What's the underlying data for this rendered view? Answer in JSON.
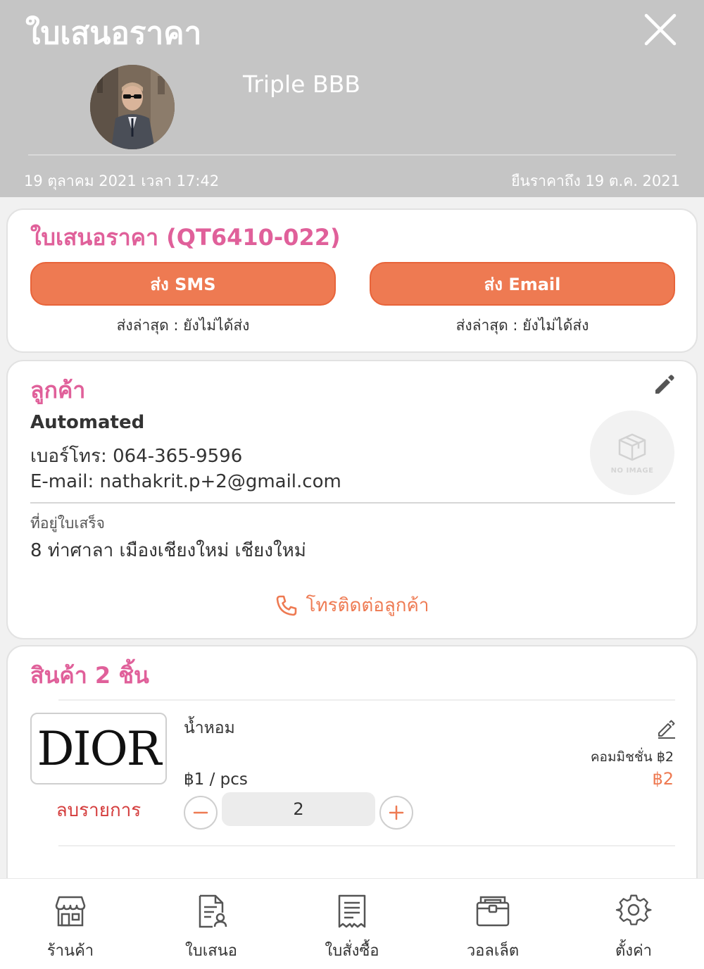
{
  "header": {
    "title": "ใบเสนอราคา",
    "shop_name": "Triple BBB",
    "date": "19 ตุลาคม 2021 เวลา 17:42",
    "valid_until": "ยืนราคาถึง 19 ต.ค. 2021"
  },
  "quote": {
    "title": "ใบเสนอราคา (QT6410-022)",
    "sms_button": "ส่ง SMS",
    "email_button": "ส่ง Email",
    "sms_last_sent": "ส่งล่าสุด : ยังไม่ได้ส่ง",
    "email_last_sent": "ส่งล่าสุด : ยังไม่ได้ส่ง"
  },
  "customer": {
    "section_title": "ลูกค้า",
    "name": "Automated",
    "phone": "เบอร์โทร: 064-365-9596",
    "email": "E-mail: nathakrit.p+2@gmail.com",
    "no_image_label": "NO IMAGE",
    "address_label": "ที่อยู่ใบเสร็จ",
    "address": "8 ท่าศาลา เมืองเชียงใหม่ เชียงใหม่",
    "call_label": "โทรติดต่อลูกค้า"
  },
  "products": {
    "section_title": "สินค้า 2 ชิ้น",
    "items": [
      {
        "brand_logo_text": "DIOR",
        "name": "น้ำหอม",
        "unit_price": "฿1 / pcs",
        "commission": "คอมมิชชั่น ฿2",
        "total": "฿2",
        "quantity": "2",
        "remove_label": "ลบรายการ"
      }
    ]
  },
  "bottom_nav": [
    {
      "label": "ร้านค้า",
      "icon": "store-icon"
    },
    {
      "label": "ใบเสนอ",
      "icon": "quote-document-icon"
    },
    {
      "label": "ใบสั่งซื้อ",
      "icon": "receipt-icon"
    },
    {
      "label": "วอลเล็ต",
      "icon": "wallet-icon"
    },
    {
      "label": "ตั้งค่า",
      "icon": "gear-icon"
    }
  ],
  "colors": {
    "header_bg": "#c5c5c5",
    "accent_orange": "#ee7a52",
    "pink_title": "#e0609a",
    "remove_red": "#d43c3c"
  }
}
